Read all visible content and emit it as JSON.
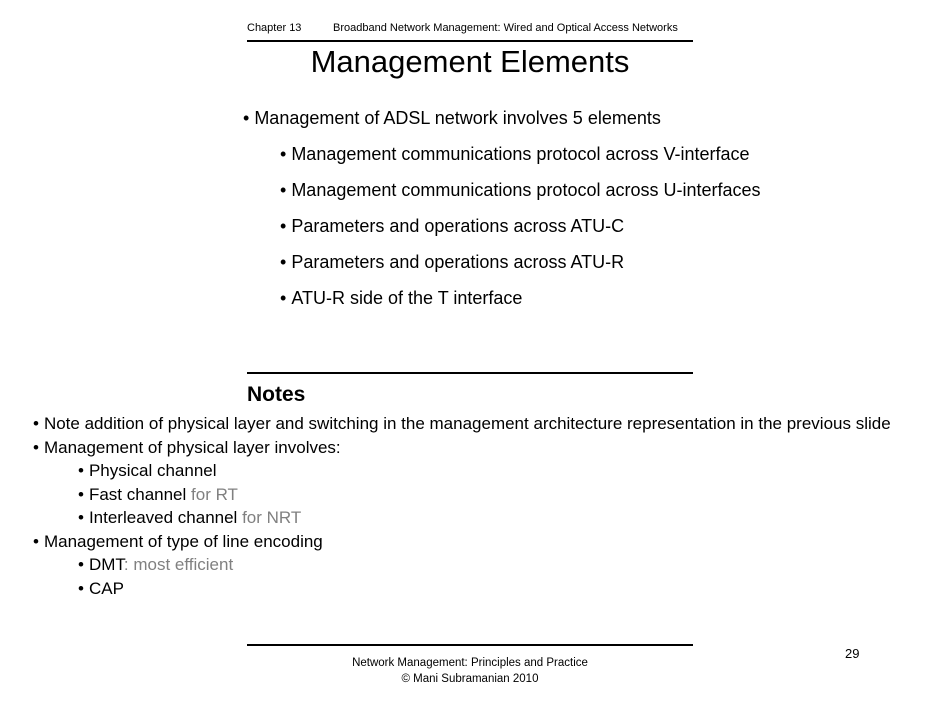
{
  "slide": {
    "header": {
      "chapter": "Chapter 13",
      "subject": "Broadband Network Management:  Wired and Optical Access Networks"
    },
    "title": "Management Elements",
    "bullets": [
      {
        "level": 1,
        "text": "Management of ADSL network involves 5 elements"
      },
      {
        "level": 2,
        "text": "Management communications protocol across V-interface"
      },
      {
        "level": 2,
        "text": "Management communications protocol across U-interfaces"
      },
      {
        "level": 2,
        "text": "Parameters and operations across ATU-C"
      },
      {
        "level": 2,
        "text": "Parameters and operations across ATU-R"
      },
      {
        "level": 2,
        "text": "ATU-R side of the T interface"
      }
    ]
  },
  "notes": {
    "heading": "Notes",
    "lines": [
      {
        "level": 1,
        "text": "Note addition of physical layer and switching in the management architecture representation in the previous slide"
      },
      {
        "level": 1,
        "text": "Management of physical layer involves:"
      },
      {
        "level": 2,
        "text": "Physical channel"
      },
      {
        "level": 2,
        "text": "Fast channel",
        "gray_suffix": " for RT"
      },
      {
        "level": 2,
        "text": "Interleaved channel",
        "gray_suffix": " for NRT"
      },
      {
        "level": 1,
        "text": "Management of type of line encoding"
      },
      {
        "level": 2,
        "text": "DMT",
        "gray_suffix": ": most efficient"
      },
      {
        "level": 2,
        "text": "CAP"
      }
    ]
  },
  "footer": {
    "line1": "Network Management: Principles and Practice",
    "line2": "©  Mani Subramanian 2010",
    "page_number": "29"
  },
  "symbols": {
    "bullet": "•"
  },
  "colors": {
    "text": "#000000",
    "gray_text": "#808080",
    "background": "#ffffff",
    "rule": "#000000"
  }
}
